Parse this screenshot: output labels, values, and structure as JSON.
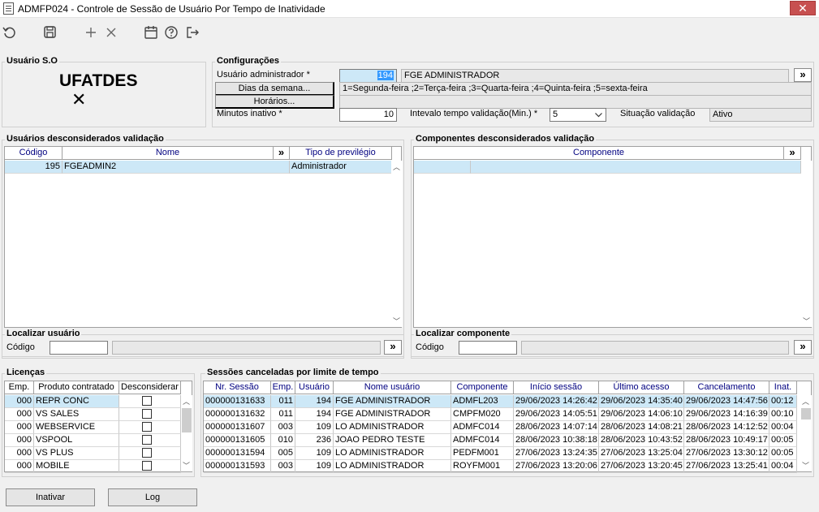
{
  "window": {
    "title": "ADMFP024 - Controle de Sessão de Usuário Por Tempo de Inatividade",
    "close_label": "✕"
  },
  "toolbar": {
    "icons": [
      "refresh-icon",
      "save-icon",
      "add-icon",
      "delete-icon",
      "calendar-icon",
      "help-icon",
      "exit-icon"
    ]
  },
  "usuario_so": {
    "title": "Usuário S.O",
    "username": "UFATDES",
    "mark": "✕"
  },
  "config": {
    "title": "Configurações",
    "admin_label": "Usuário administrador *",
    "admin_code": "194",
    "admin_name": "FGE ADMINISTRADOR",
    "dias_button": "Dias da semana...",
    "dias_value": "1=Segunda-feira ;2=Terça-feira ;3=Quarta-feira ;4=Quinta-feira ;5=sexta-feira",
    "horarios_button": "Horários...",
    "horarios_value": "",
    "minutos_label": "Minutos inativo *",
    "minutos_value": "10",
    "intervalo_label": "Intevalo tempo validação(Min.) *",
    "intervalo_value": "5",
    "situacao_label": "Situação validação",
    "situacao_value": "Ativo",
    "expand": "»"
  },
  "usuarios_desc": {
    "title": "Usuários desconsiderados validação",
    "headers": [
      "Código",
      "Nome",
      "»",
      "Tipo de previlégio"
    ],
    "rows": [
      {
        "codigo": "195",
        "nome": "FGEADMIN2",
        "tipo": "Administrador"
      }
    ],
    "localizar_title": "Localizar usuário",
    "codigo_label": "Código",
    "codigo_value": "",
    "expand": "»"
  },
  "componentes_desc": {
    "title": "Componentes desconsiderados validação",
    "headers": [
      "Componente",
      "»"
    ],
    "localizar_title": "Localizar componente",
    "codigo_label": "Código",
    "codigo_value": "",
    "expand": "»"
  },
  "licencas": {
    "title": "Licenças",
    "headers": [
      "Emp.",
      "Produto contratado",
      "Desconsiderar"
    ],
    "rows": [
      {
        "emp": "000",
        "produto": "REPR CONC",
        "checked": false
      },
      {
        "emp": "000",
        "produto": "VS SALES",
        "checked": false
      },
      {
        "emp": "000",
        "produto": "WEBSERVICE",
        "checked": false
      },
      {
        "emp": "000",
        "produto": "VSPOOL",
        "checked": false
      },
      {
        "emp": "000",
        "produto": "VS PLUS",
        "checked": false
      },
      {
        "emp": "000",
        "produto": "MOBILE",
        "checked": false
      }
    ]
  },
  "sessoes": {
    "title": "Sessões canceladas por limite de tempo",
    "headers": [
      "Nr. Sessão",
      "Emp.",
      "Usuário",
      "Nome usuário",
      "Componente",
      "Início sessão",
      "Último acesso",
      "Cancelamento",
      "Inat."
    ],
    "rows": [
      [
        "000000131633",
        "011",
        "194",
        "FGE ADMINISTRADOR",
        "ADMFL203",
        "29/06/2023 14:26:42",
        "29/06/2023 14:35:40",
        "29/06/2023 14:47:56",
        "00:12"
      ],
      [
        "000000131632",
        "011",
        "194",
        "FGE ADMINISTRADOR",
        "CMPFM020",
        "29/06/2023 14:05:51",
        "29/06/2023 14:06:10",
        "29/06/2023 14:16:39",
        "00:10"
      ],
      [
        "000000131607",
        "003",
        "109",
        "LO ADMINISTRADOR",
        "ADMFC014",
        "28/06/2023 14:07:14",
        "28/06/2023 14:08:21",
        "28/06/2023 14:12:52",
        "00:04"
      ],
      [
        "000000131605",
        "010",
        "236",
        "JOAO PEDRO TESTE",
        "ADMFC014",
        "28/06/2023 10:38:18",
        "28/06/2023 10:43:52",
        "28/06/2023 10:49:17",
        "00:05"
      ],
      [
        "000000131594",
        "005",
        "109",
        "LO ADMINISTRADOR",
        "PEDFM001",
        "27/06/2023 13:24:35",
        "27/06/2023 13:25:04",
        "27/06/2023 13:30:12",
        "00:05"
      ],
      [
        "000000131593",
        "003",
        "109",
        "LO ADMINISTRADOR",
        "ROYFM001",
        "27/06/2023 13:20:06",
        "27/06/2023 13:20:45",
        "27/06/2023 13:25:41",
        "00:04"
      ]
    ]
  },
  "footer": {
    "inativar_button": "Inativar",
    "log_button": "Log"
  }
}
